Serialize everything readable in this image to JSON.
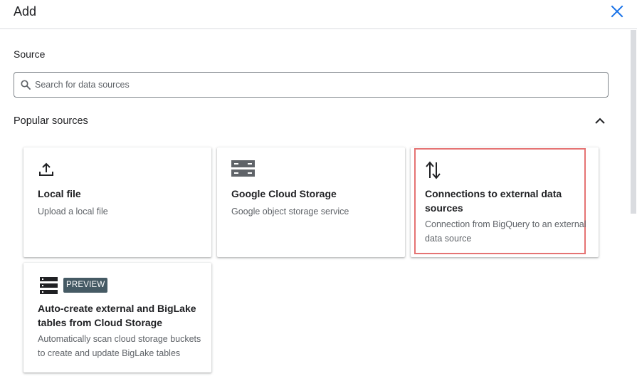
{
  "dialog": {
    "title": "Add",
    "close_icon": "close-icon"
  },
  "source": {
    "label": "Source",
    "search_placeholder": "Search for data sources",
    "search_value": ""
  },
  "popular": {
    "title": "Popular sources",
    "expanded": true,
    "cards": [
      {
        "title": "Local file",
        "description": "Upload a local file",
        "icon": "upload-icon"
      },
      {
        "title": "Google Cloud Storage",
        "description": "Google object storage service",
        "icon": "cloud-storage-icon"
      },
      {
        "title": "Connections to external data sources",
        "description": "Connection from BigQuery to an external data source",
        "icon": "swap-vertical-icon",
        "highlighted": true
      },
      {
        "title": "Auto-create external and BigLake tables from Cloud Storage",
        "description": "Automatically scan cloud storage buckets to create and update BigLake tables",
        "icon": "table-list-icon",
        "badge": "PREVIEW"
      }
    ]
  },
  "colors": {
    "accent": "#1a73e8",
    "highlight_border": "#e57373",
    "badge_bg": "#455a64"
  }
}
